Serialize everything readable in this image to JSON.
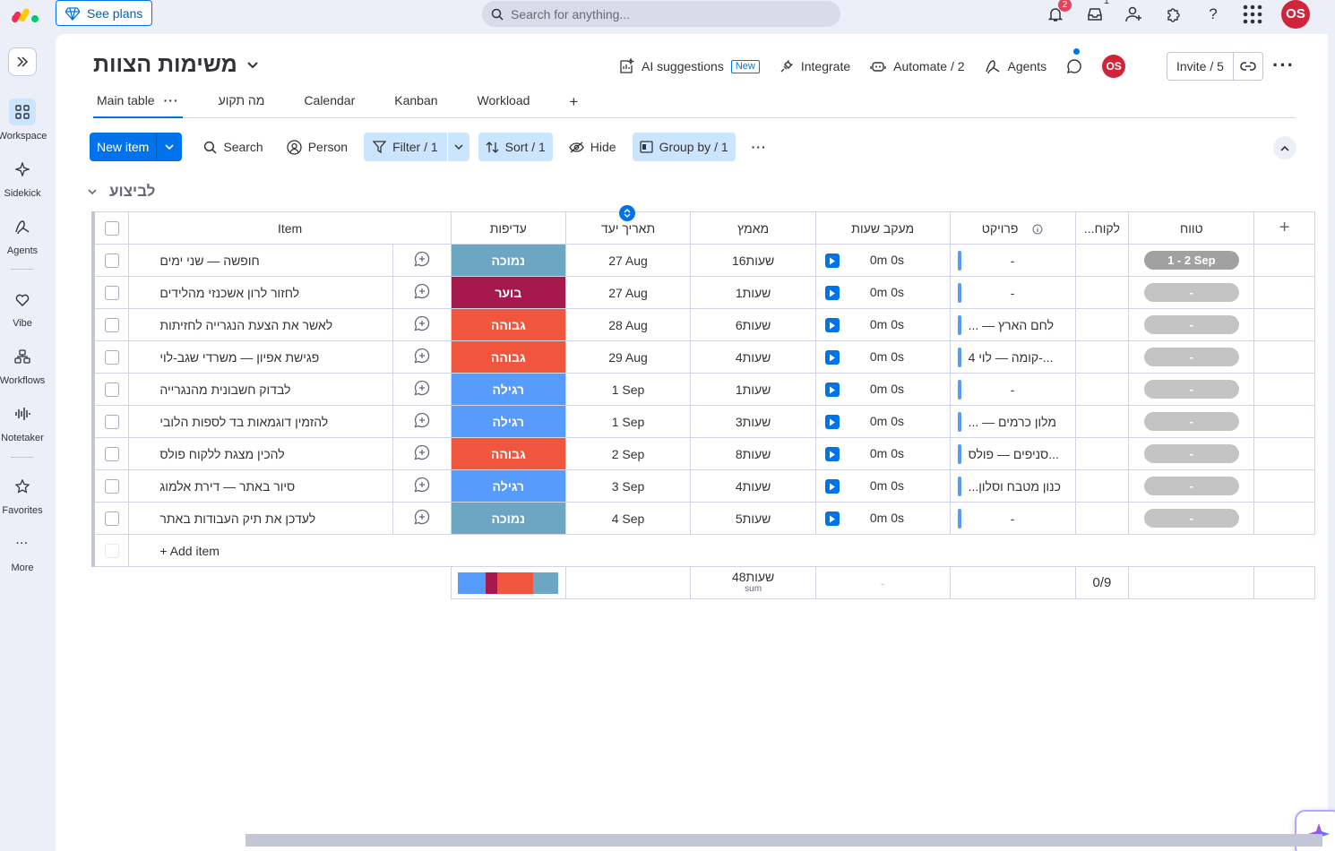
{
  "topbar": {
    "see_plans": "See plans",
    "search_placeholder": "Search for anything...",
    "notifications_count": "2",
    "inbox_count": "1",
    "avatar_initials": "OS"
  },
  "sidebar": {
    "items": [
      {
        "label": "Workspace"
      },
      {
        "label": "Sidekick"
      },
      {
        "label": "Agents"
      },
      {
        "label": "Vibe"
      },
      {
        "label": "Workflows"
      },
      {
        "label": "Notetaker"
      },
      {
        "label": "Favorites"
      },
      {
        "label": "More"
      }
    ]
  },
  "board": {
    "title": "משימות הצוות",
    "ai_suggestions": "AI suggestions",
    "new_tag": "New",
    "integrate": "Integrate",
    "automate": "Automate / 2",
    "agents": "Agents",
    "avatar_initials": "OS",
    "invite": "Invite / 5"
  },
  "tabs": [
    "Main table",
    "מה תקוע",
    "Calendar",
    "Kanban",
    "Workload"
  ],
  "toolbar": {
    "new_item": "New item",
    "search": "Search",
    "person": "Person",
    "filter": "Filter / 1",
    "sort": "Sort / 1",
    "hide": "Hide",
    "group_by": "Group by / 1"
  },
  "group": {
    "title": "לביצוע"
  },
  "columns": {
    "item": "Item",
    "priority": "עדיפות",
    "due": "תאריך יעד",
    "effort": "מאמץ",
    "time_tracking": "מעקב שעות",
    "project": "פרויקט",
    "client": "...לקוח",
    "range": "טווח"
  },
  "rows": [
    {
      "item": "חופשה — שני ימים",
      "priority": "נמוכה",
      "priority_color": "#6ca6c3",
      "due": "27 Aug",
      "effort": "16שעות",
      "time": "0m 0s",
      "project": "-",
      "range": "1 - 2 Sep",
      "range_set": true
    },
    {
      "item": "לחזור לרון אשכנזי מהלידים",
      "priority": "בוער",
      "priority_color": "#a5194c",
      "due": "27 Aug",
      "effort": "1שעות",
      "time": "0m 0s",
      "project": "-",
      "range": "-",
      "range_set": false
    },
    {
      "item": "לאשר את הצעת הנגרייה לחזיתות",
      "priority": "גבוהה",
      "priority_color": "#f0553d",
      "due": "28 Aug",
      "effort": "6שעות",
      "time": "0m 0s",
      "project": "... — לחם הארץ",
      "range": "-",
      "range_set": false
    },
    {
      "item": "פגישת אפיון — משרדי שגב-לוי",
      "priority": "גבוהה",
      "priority_color": "#f0553d",
      "due": "29 Aug",
      "effort": "4שעות",
      "time": "0m 0s",
      "project": "4 קומה — לוי-...",
      "range": "-",
      "range_set": false
    },
    {
      "item": "לבדוק חשבונית מהנגרייה",
      "priority": "רגילה",
      "priority_color": "#579bfc",
      "due": "1 Sep",
      "effort": "1שעות",
      "time": "0m 0s",
      "project": "-",
      "range": "-",
      "range_set": false
    },
    {
      "item": "להזמין דוגמאות בד לספות הלובי",
      "priority": "רגילה",
      "priority_color": "#579bfc",
      "due": "1 Sep",
      "effort": "3שעות",
      "time": "0m 0s",
      "project": "... — מלון כרמים",
      "range": "-",
      "range_set": false
    },
    {
      "item": "להכין מצגת ללקוח פולס",
      "priority": "גבוהה",
      "priority_color": "#f0553d",
      "due": "2 Sep",
      "effort": "8שעות",
      "time": "0m 0s",
      "project": "סניפים — פולס...",
      "range": "-",
      "range_set": false
    },
    {
      "item": "סיור באתר — דירת אלמוג",
      "priority": "רגילה",
      "priority_color": "#579bfc",
      "due": "3 Sep",
      "effort": "4שעות",
      "time": "0m 0s",
      "project": "...כנון מטבח וסלון",
      "range": "-",
      "range_set": false
    },
    {
      "item": "לעדכן את תיק העבודות באתר",
      "priority": "נמוכה",
      "priority_color": "#6ca6c3",
      "due": "4 Sep",
      "effort": "5שעות",
      "time": "0m 0s",
      "project": "-",
      "range": "-",
      "range_set": false
    }
  ],
  "add_item": "+ Add item",
  "summary": {
    "priority_segments": [
      {
        "color": "#579bfc",
        "share": 0.27
      },
      {
        "color": "#a5194c",
        "share": 0.12
      },
      {
        "color": "#f0553d",
        "share": 0.36
      },
      {
        "color": "#6ca6c3",
        "share": 0.25
      }
    ],
    "effort_total": "48שעות",
    "effort_label": "sum",
    "time_total": "-",
    "client_progress": "0/9"
  }
}
